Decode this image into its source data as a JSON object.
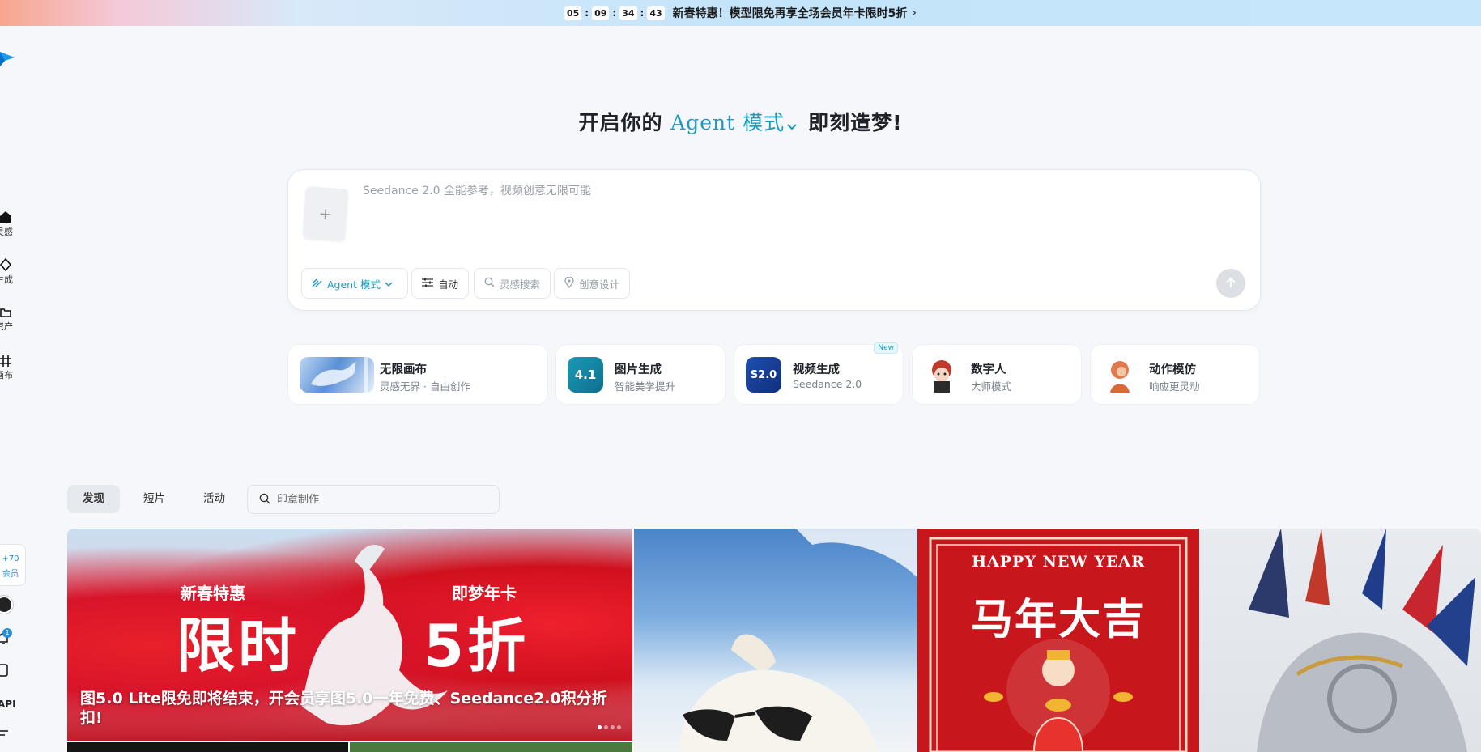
{
  "promo": {
    "timer": [
      "05",
      "09",
      "34",
      "43"
    ],
    "text": "新春特惠！模型限免再享全场会员年卡限时5折",
    "arrow": "›"
  },
  "sidebar": {
    "items": [
      {
        "label": "灵感",
        "icon": "home-icon"
      },
      {
        "label": "生成",
        "icon": "diamond-icon"
      },
      {
        "label": "资产",
        "icon": "folder-icon"
      },
      {
        "label": "画布",
        "icon": "canvas-icon"
      }
    ],
    "credits_value": "+70",
    "credits_label": "会员",
    "bell_badge": "1",
    "api_label": "API"
  },
  "hero": {
    "prefix": "开启你的",
    "mode": "Agent 模式",
    "suffix": "即刻造梦!"
  },
  "prompt": {
    "placeholder": "Seedance 2.0 全能参考，视频创意无限可能",
    "upload_icon": "+",
    "tools": {
      "agent": "Agent 模式",
      "auto": "自动",
      "search": "灵感搜索",
      "design": "创意设计"
    }
  },
  "cards": [
    {
      "title": "无限画布",
      "sub": "灵感无界 · 自由创作"
    },
    {
      "title": "图片生成",
      "sub": "智能美学提升",
      "thumb_text": "4.1"
    },
    {
      "title": "视频生成",
      "sub": "Seedance 2.0",
      "badge": "New",
      "thumb_text": "S2.0"
    },
    {
      "title": "数字人",
      "sub": "大师模式"
    },
    {
      "title": "动作模仿",
      "sub": "响应更灵动"
    }
  ],
  "feed": {
    "tabs": [
      "发现",
      "短片",
      "活动"
    ],
    "search_placeholder": "印章制作"
  },
  "gallery": {
    "banner": {
      "left_small": "新春特惠",
      "left_big": "限时",
      "right_small": "即梦年卡",
      "right_big": "5折",
      "caption": "图5.0 Lite限免即将结束，开会员享图5.0一年免费、Seedance2.0积分折扣!"
    },
    "poster": {
      "top_text": "HAPPY NEW YEAR",
      "title": "马年大吉"
    }
  },
  "colors": {
    "accent": "#1a9bbf",
    "poster_red": "#c8161d"
  }
}
